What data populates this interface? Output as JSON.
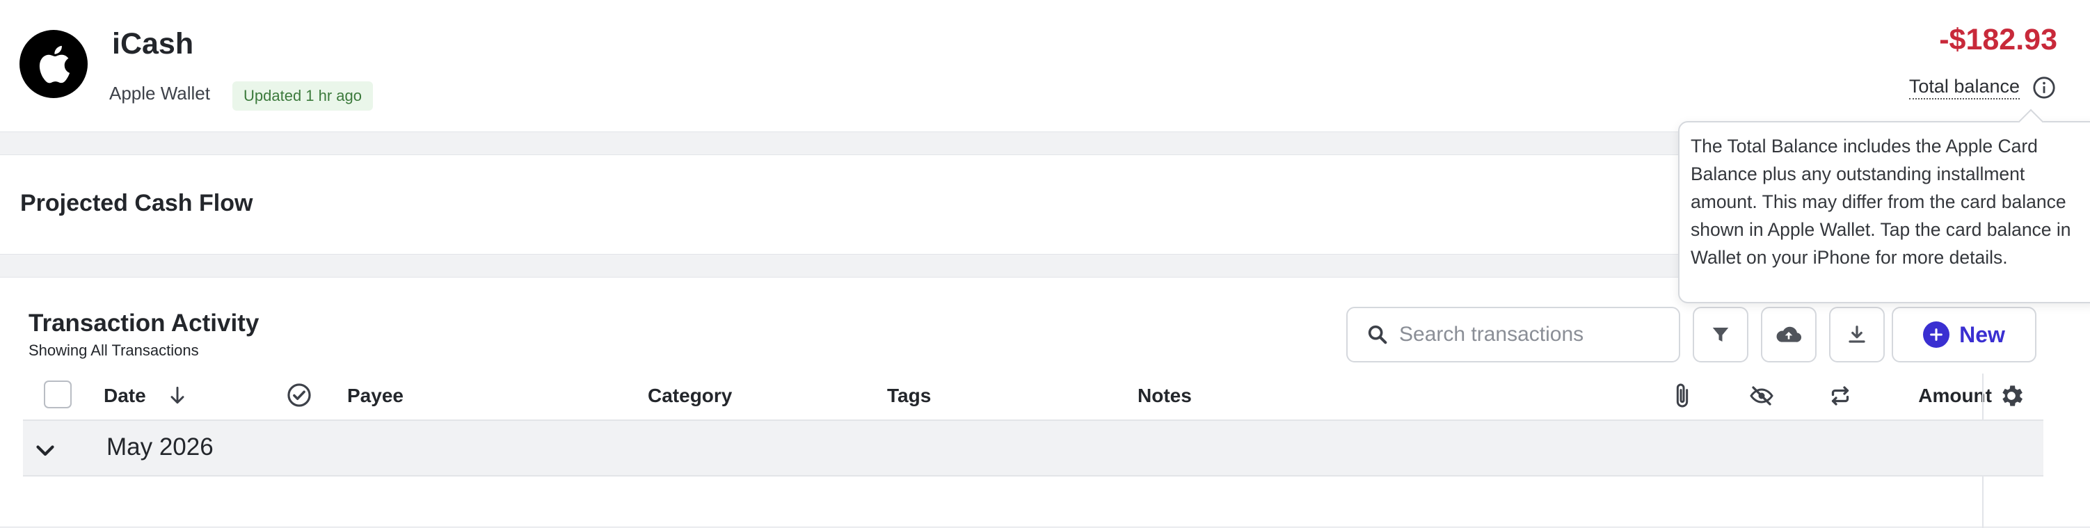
{
  "account": {
    "name": "iCash",
    "provider": "Apple Wallet",
    "updated": "Updated 1 hr ago",
    "balance": "-$182.93",
    "balance_label": "Total balance",
    "tooltip": "The Total Balance includes the Apple Card Balance plus any outstanding installment amount. This may differ from the card balance shown in Apple Wallet. Tap the card balance in Wallet on your iPhone for more details.",
    "logo_icon": "apple-logo-icon",
    "info_icon": "info-icon"
  },
  "cashflow": {
    "title": "Projected Cash Flow"
  },
  "transactions": {
    "title": "Transaction Activity",
    "subtitle": "Showing All Transactions",
    "search_placeholder": "Search transactions",
    "new_label": "New",
    "toolbar_icons": [
      "filter-icon",
      "cloud-upload-icon",
      "download-icon"
    ],
    "columns": {
      "date": "Date",
      "payee": "Payee",
      "category": "Category",
      "tags": "Tags",
      "notes": "Notes",
      "amount": "Amount"
    },
    "column_icons": [
      "sort-down-icon",
      "reviewed-check-icon",
      "attachment-icon",
      "hidden-eye-icon",
      "recurring-icon",
      "settings-gear-icon"
    ],
    "groups": [
      {
        "label": "May 2026"
      }
    ]
  },
  "colors": {
    "negative": "#c8293a",
    "accent": "#3a2fd1",
    "badge_bg": "#eaf6ea",
    "badge_text": "#3c7a3c"
  }
}
